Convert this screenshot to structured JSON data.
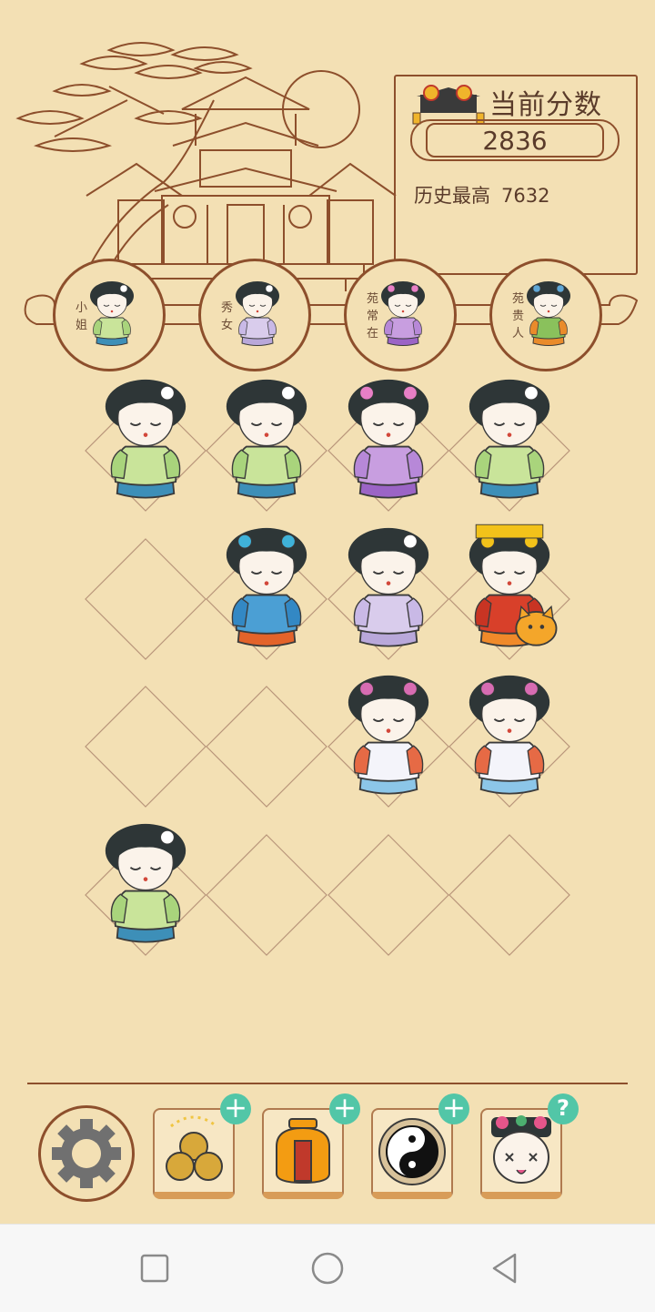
{
  "score": {
    "title": "当前分数",
    "current": "2836",
    "best_label": "历史最高",
    "best_value": "7632"
  },
  "ranks": [
    {
      "label": "小姐",
      "lines": [
        "小",
        "姐"
      ],
      "figure": "girl-green-icon"
    },
    {
      "label": "秀女",
      "lines": [
        "秀",
        "女"
      ],
      "figure": "girl-lavender-icon"
    },
    {
      "label": "苑常在",
      "lines": [
        "苑",
        "常",
        "在"
      ],
      "figure": "consort-purple-icon"
    },
    {
      "label": "苑贵人",
      "lines": [
        "苑",
        "贵",
        "人"
      ],
      "figure": "consort-green-orange-icon"
    }
  ],
  "board_pieces": [
    {
      "row": 0,
      "col": 0,
      "figure": "girl-green-icon"
    },
    {
      "row": 0,
      "col": 1,
      "figure": "girl-green-icon"
    },
    {
      "row": 0,
      "col": 2,
      "figure": "consort-purple-icon"
    },
    {
      "row": 0,
      "col": 3,
      "figure": "girl-green-icon"
    },
    {
      "row": 1,
      "col": 1,
      "figure": "consort-blue-icon"
    },
    {
      "row": 1,
      "col": 2,
      "figure": "girl-lavender-icon"
    },
    {
      "row": 1,
      "col": 3,
      "figure": "empress-red-with-cat-icon"
    },
    {
      "row": 2,
      "col": 2,
      "figure": "concubine-white-icon"
    },
    {
      "row": 2,
      "col": 3,
      "figure": "concubine-white-icon"
    },
    {
      "row": 3,
      "col": 0,
      "figure": "girl-green-icon"
    }
  ],
  "toolbar": [
    {
      "name": "settings",
      "icon": "gear-icon",
      "badge": ""
    },
    {
      "name": "coins",
      "icon": "coins-icon",
      "badge": "+"
    },
    {
      "name": "jar",
      "icon": "jar-icon",
      "badge": "+"
    },
    {
      "name": "yin-yang",
      "icon": "yin-yang-icon",
      "badge": "+"
    },
    {
      "name": "help",
      "icon": "character-face-icon",
      "badge": "?"
    }
  ],
  "nav": [
    "recent-apps-icon",
    "home-icon",
    "back-icon"
  ],
  "colors": {
    "background": "#f3e0b4",
    "ink": "#8d4f2c",
    "accent": "#52c6a7"
  }
}
